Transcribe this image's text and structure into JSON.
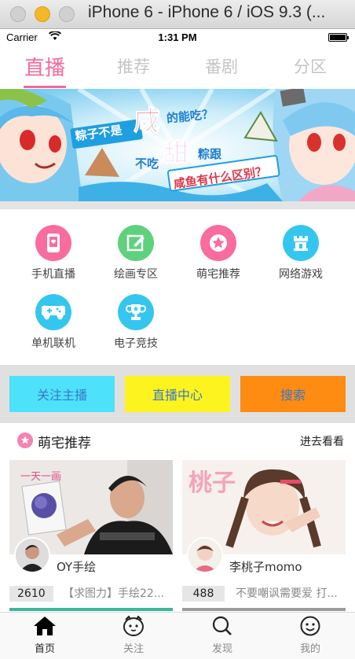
{
  "window": {
    "title": "iPhone 6 - iPhone 6 / iOS 9.3 (..."
  },
  "status_bar": {
    "carrier": "Carrier",
    "time": "1:31 PM",
    "battery_level": 1.0
  },
  "top_tabs": [
    {
      "label": "直播",
      "active": true
    },
    {
      "label": "推荐",
      "active": false
    },
    {
      "label": "番剧",
      "active": false
    },
    {
      "label": "分区",
      "active": false
    }
  ],
  "banner": {
    "line1": "粽子不是",
    "big1": "咸",
    "line1_end": "的能吃？",
    "line2": "不吃",
    "big2": "甜",
    "line2_end": "粽跟",
    "line3": "咸鱼有什么区别？"
  },
  "categories": [
    {
      "label": "手机直播",
      "icon": "phone-icon",
      "color": "#f86c9e"
    },
    {
      "label": "绘画专区",
      "icon": "drawing-icon",
      "color": "#5ed17c"
    },
    {
      "label": "萌宅推荐",
      "icon": "star-icon",
      "color": "#f86c9e"
    },
    {
      "label": "网络游戏",
      "icon": "castle-icon",
      "color": "#35c6f0"
    },
    {
      "label": "单机联机",
      "icon": "gamepad-icon",
      "color": "#35c6f0"
    },
    {
      "label": "电子竞技",
      "icon": "trophy-icon",
      "color": "#35c6f0"
    }
  ],
  "buttons": [
    {
      "label": "关注主播",
      "color": "#4de1fa"
    },
    {
      "label": "直播中心",
      "color": "#fdf31e"
    },
    {
      "label": "搜索",
      "color": "#fe8b12"
    }
  ],
  "recommend": {
    "title": "萌宅推荐",
    "more": "进去看看",
    "cards": [
      {
        "name": "OY手绘",
        "count": "2610",
        "desc": "【求图力】手绘22...",
        "watermark": "一天一画"
      },
      {
        "name": "李桃子momo",
        "count": "488",
        "desc": "不要嘲讽需要爱 打...",
        "watermark": "桃子"
      }
    ]
  },
  "tab_bar": [
    {
      "label": "首页",
      "icon": "home-icon",
      "active": true
    },
    {
      "label": "关注",
      "icon": "follow-face-icon",
      "active": false
    },
    {
      "label": "发现",
      "icon": "search-icon",
      "active": false
    },
    {
      "label": "我的",
      "icon": "profile-face-icon",
      "active": false
    }
  ]
}
